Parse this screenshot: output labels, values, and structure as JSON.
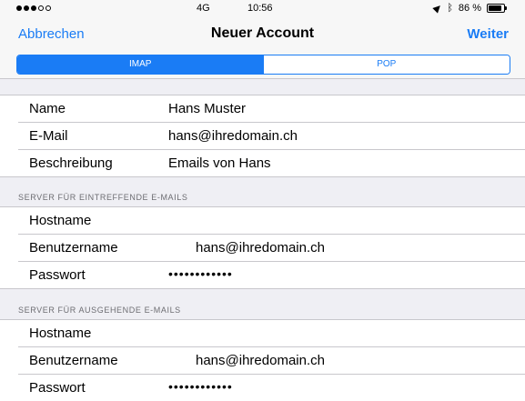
{
  "status_bar": {
    "carrier": "4G",
    "time": "10:56",
    "battery": "86 %",
    "battery_level": 0.86
  },
  "nav": {
    "cancel_label": "Abbrechen",
    "title": "Neuer Account",
    "next_label": "Weiter"
  },
  "segmented": {
    "options": [
      "IMAP",
      "POP"
    ],
    "selected": "IMAP"
  },
  "account": {
    "rows": [
      {
        "label": "Name",
        "value": "Hans Muster"
      },
      {
        "label": "E-Mail",
        "value": "hans@ihredomain.ch"
      },
      {
        "label": "Beschreibung",
        "value": "Emails von Hans"
      }
    ]
  },
  "incoming": {
    "header": "SERVER FÜR EINTREFFENDE E-MAILS",
    "rows": [
      {
        "label": "Hostname",
        "value": ""
      },
      {
        "label": "Benutzername",
        "value": "hans@ihredomain.ch"
      },
      {
        "label": "Passwort",
        "value": "••••••••••••"
      }
    ]
  },
  "outgoing": {
    "header": "SERVER FÜR AUSGEHENDE E-MAILS",
    "rows": [
      {
        "label": "Hostname",
        "value": ""
      },
      {
        "label": "Benutzername",
        "value": "hans@ihredomain.ch"
      },
      {
        "label": "Passwort",
        "value": "••••••••••••"
      }
    ]
  }
}
